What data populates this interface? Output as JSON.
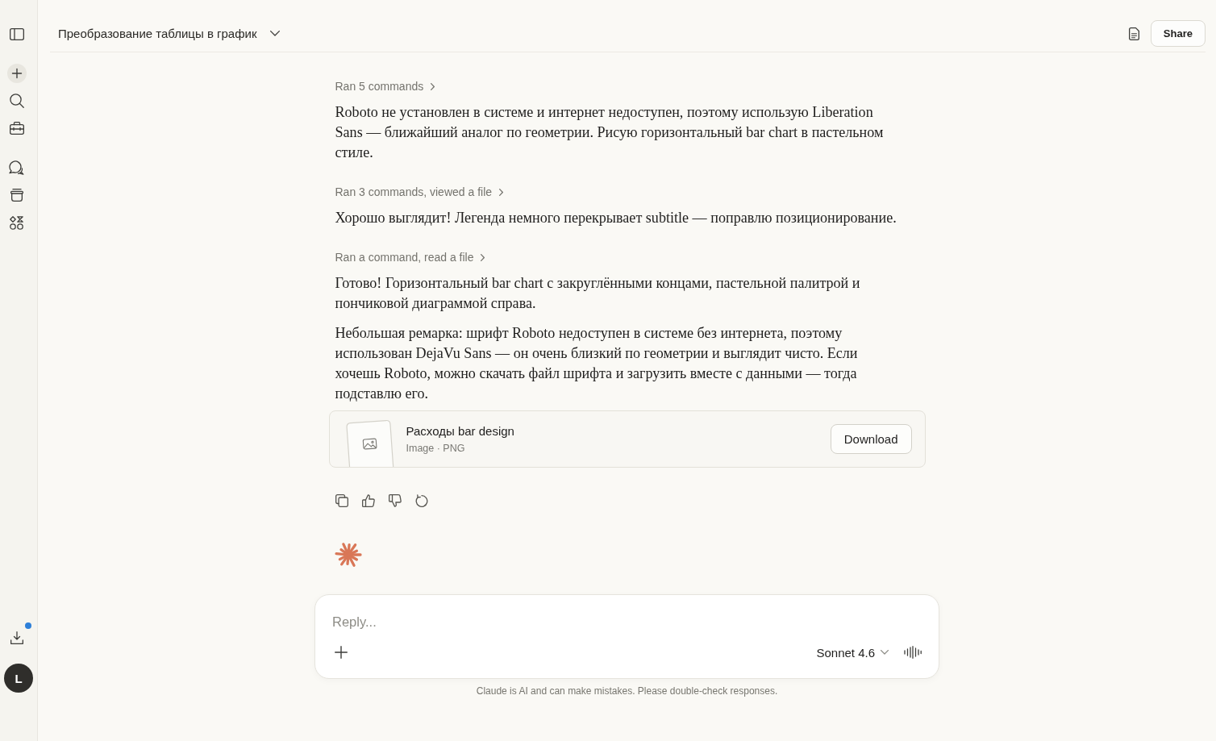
{
  "sidebar": {
    "download_notification": true,
    "avatar_initial": "L"
  },
  "header": {
    "title": "Преобразование таблицы в график",
    "share_label": "Share"
  },
  "conversation": [
    {
      "kind": "steps",
      "text": "Ran 5 commands"
    },
    {
      "kind": "paragraph",
      "text": "Roboto не установлен в системе и интернет недоступен, поэтому использую Liberation Sans — ближайший аналог по геометрии. Рисую горизонтальный bar chart в пастельном стиле."
    },
    {
      "kind": "steps",
      "text": "Ran 3 commands, viewed a file"
    },
    {
      "kind": "paragraph",
      "text": "Хорошо выглядит! Легенда немного перекрывает subtitle — поправлю позиционирование."
    },
    {
      "kind": "steps",
      "text": "Ran a command, read a file"
    },
    {
      "kind": "paragraph",
      "text": "Готово! Горизонтальный bar chart с закруглёнными концами, пастельной палитрой и пончиковой диаграммой справа."
    },
    {
      "kind": "paragraph",
      "text": "Небольшая ремарка: шрифт Roboto недоступен в системе без интернета, поэтому использован DejaVu Sans — он очень близкий по геометрии и выглядит чисто. Если хочешь Roboto, можно скачать файл шрифта и загрузить вместе с данными — тогда подставлю его."
    },
    {
      "kind": "file",
      "name": "Расходы bar design",
      "meta": "Image · PNG",
      "action": "Download"
    }
  ],
  "composer": {
    "placeholder": "Reply...",
    "model": "Sonnet 4.6"
  },
  "disclaimer": "Claude is AI and can make mistakes. Please double-check responses."
}
